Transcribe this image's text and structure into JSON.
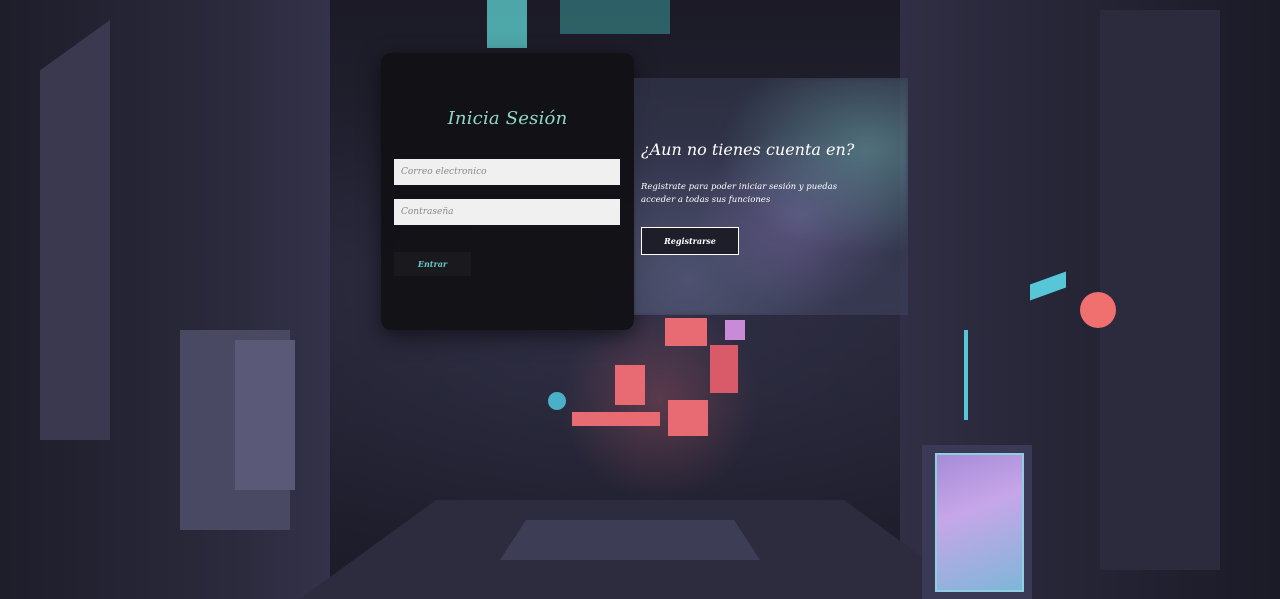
{
  "colors": {
    "accent_title": "#8fd8c8",
    "accent_button_text": "#62c9c9",
    "card_background": "#101014",
    "input_background": "#f0f0f0",
    "panel_text": "#ffffff"
  },
  "login": {
    "title": "Inicia Sesión",
    "email_placeholder": "Correo electronico",
    "password_placeholder": "Contraseña",
    "submit_label": "Entrar"
  },
  "register": {
    "title": "¿Aun no tienes cuenta en?",
    "description": "Registrate para poder iniciar sesión y puedas acceder a todas sus funciones",
    "button_label": "Registrarse"
  }
}
